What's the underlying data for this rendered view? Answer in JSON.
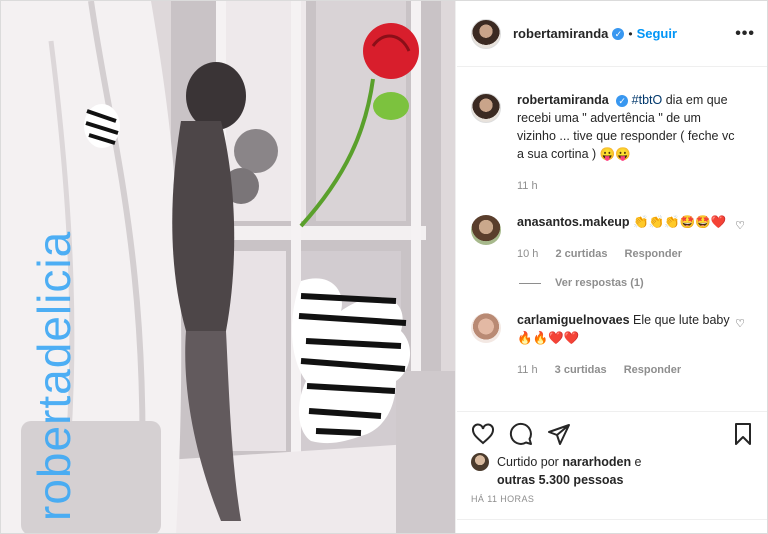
{
  "photo": {
    "overlay_text": "robertadelicia"
  },
  "header": {
    "username": "robertamiranda",
    "verified_mark": "✓",
    "follow_label": "Seguir",
    "more_label": "•••"
  },
  "caption": {
    "username": "robertamiranda",
    "hashtag": "#tbtO",
    "text": " dia em que recebi uma \" advertência \" de um vizinho ... tive que responder ( feche vc a sua cortina ) 😛😛",
    "time": "11 h"
  },
  "comments": [
    {
      "username": "anasantos.makeup",
      "text": " 👏👏👏🤩🤩❤️",
      "time": "10 h",
      "likes": "2 curtidas",
      "reply": "Responder",
      "view_replies": "Ver respostas (1)"
    },
    {
      "username": "carlamiguelnovaes",
      "text": " Ele que lute baby🔥🔥❤️❤️",
      "time": "11 h",
      "likes": "3 curtidas",
      "reply": "Responder"
    }
  ],
  "likes": {
    "prefix": "Curtido por ",
    "user": "nararhoden",
    "mid": " e",
    "others": "outras 5.300 pessoas"
  },
  "date": "HÁ 11 HORAS",
  "colors": {
    "accent": "#0095f6",
    "overlay": "#3fa9f5",
    "heart": "#e0245e"
  }
}
